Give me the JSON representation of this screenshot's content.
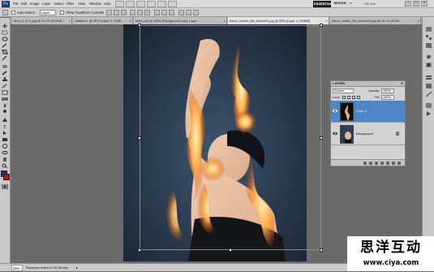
{
  "app": {
    "logo": "Ps"
  },
  "menu": [
    "File",
    "Edit",
    "Image",
    "Layer",
    "Select",
    "Filter",
    "View",
    "Window",
    "Help"
  ],
  "workspace": {
    "essentials": "ESSENTIALS",
    "design": "DESIGN",
    "more": "»",
    "cs_live": "CS Live"
  },
  "options": {
    "auto_select_label": "Auto-Select:",
    "auto_select_value": "Layer",
    "show_transform_label": "Show Transform Controls"
  },
  "tabs": [
    {
      "label": "Burn (1 of 3).jpg @ 33.3% (RGB/8..."
    },
    {
      "label": "Untitled-1 @ 25% (Layer 2, RGB/..."
    },
    {
      "label": "test1.psd @ 100% (Background copy, Layer ..."
    },
    {
      "label": "blend_modes_fire_before01.jpg @ 25% (Layer 1, RGB/8)",
      "active": true
    },
    {
      "label": "blend_modes_fire_before03.jpg @ 16.7% (RGB..."
    }
  ],
  "layers_panel": {
    "title": "LAYERS",
    "blend_mode": "Screen",
    "opacity_label": "Opacity:",
    "opacity_value": "100%",
    "lock_label": "Lock:",
    "fill_label": "Fill:",
    "fill_value": "100%",
    "layers": [
      {
        "name": "Layer 1",
        "selected": true
      },
      {
        "name": "Background",
        "locked": true
      }
    ]
  },
  "status": {
    "zoom": "25%",
    "info": "Exposure works in 32-bit only"
  },
  "watermark": {
    "title": "思洋互动",
    "url": "www.ciya.com"
  },
  "colors": {
    "accent_selected": "#4b86c9",
    "fire": "#ffb255",
    "backdrop": "#2a3f55"
  }
}
